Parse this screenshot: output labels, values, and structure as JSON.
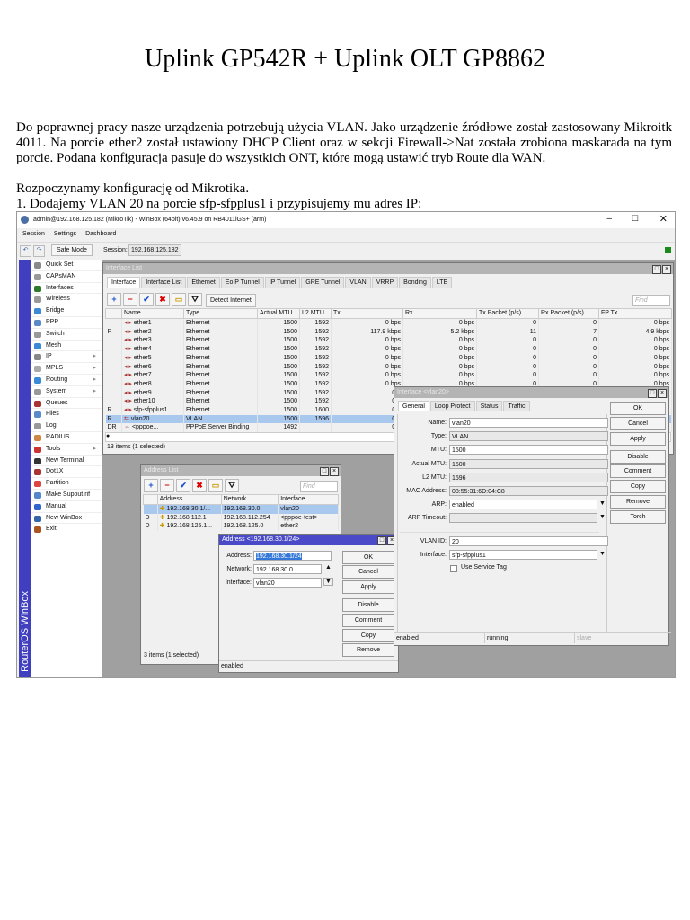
{
  "doc": {
    "title": "Uplink GP542R + Uplink OLT GP8862",
    "p1": "Do poprawnej pracy nasze urządzenia potrzebują użycia VLAN. Jako urządzenie źródłowe został zastosowany Mikroitk 4011. Na porcie ether2 został ustawiony DHCP Client oraz w sekcji Firewall->Nat została zrobiona maskarada na tym porcie. Podana konfiguracja pasuje do wszystkich ONT, które mogą ustawić tryb Route dla WAN.",
    "p2": "Rozpoczynamy konfigurację od Mikrotika.",
    "p3": "1. Dodajemy VLAN 20 na porcie sfp-sfpplus1 i przypisujemy mu adres IP:"
  },
  "winbox": {
    "title": "admin@192.168.125.182 (MikroTik) - WinBox (64bit) v6.45.9 on RB4011iGS+ (arm)",
    "menu": [
      "Session",
      "Settings",
      "Dashboard"
    ],
    "safe_mode": "Safe Mode",
    "session_label": "Session:",
    "session_value": "192.168.125.182",
    "brand": "RouterOS WinBox",
    "sidebar": [
      {
        "label": "Quick Set",
        "c": "#8a8a8a"
      },
      {
        "label": "CAPsMAN",
        "c": "#999"
      },
      {
        "label": "Interfaces",
        "c": "#2d7a2d"
      },
      {
        "label": "Wireless",
        "c": "#999"
      },
      {
        "label": "Bridge",
        "c": "#3a8ad8"
      },
      {
        "label": "PPP",
        "c": "#5a8ac8"
      },
      {
        "label": "Switch",
        "c": "#999"
      },
      {
        "label": "Mesh",
        "c": "#3a8ad8"
      },
      {
        "label": "IP",
        "c": "#888",
        "sub": true
      },
      {
        "label": "MPLS",
        "c": "#aaa",
        "sub": true
      },
      {
        "label": "Routing",
        "c": "#3a8ad8",
        "sub": true
      },
      {
        "label": "System",
        "c": "#999",
        "sub": true
      },
      {
        "label": "Queues",
        "c": "#a33"
      },
      {
        "label": "Files",
        "c": "#5a8ac8"
      },
      {
        "label": "Log",
        "c": "#999"
      },
      {
        "label": "RADIUS",
        "c": "#c84"
      },
      {
        "label": "Tools",
        "c": "#c33",
        "sub": true
      },
      {
        "label": "New Terminal",
        "c": "#333"
      },
      {
        "label": "Dot1X",
        "c": "#a33"
      },
      {
        "label": "Partition",
        "c": "#d44"
      },
      {
        "label": "Make Supout.rif",
        "c": "#58c"
      },
      {
        "label": "Manual",
        "c": "#36c"
      },
      {
        "label": "New WinBox",
        "c": "#36a"
      },
      {
        "label": "Exit",
        "c": "#a52"
      }
    ],
    "iface_list": {
      "title": "Interface List",
      "tabs": [
        "Interface",
        "Interface List",
        "Ethernet",
        "EoIP Tunnel",
        "IP Tunnel",
        "GRE Tunnel",
        "VLAN",
        "VRRP",
        "Bonding",
        "LTE"
      ],
      "detect": "Detect Internet",
      "find": "Find",
      "columns": [
        "",
        "Name",
        "Type",
        "Actual MTU",
        "L2 MTU",
        "Tx",
        "Rx",
        "Tx Packet (p/s)",
        "Rx Packet (p/s)",
        "FP Tx"
      ],
      "rows": [
        [
          "",
          "ether1",
          "Ethernet",
          "1500",
          "1592",
          "0 bps",
          "0 bps",
          "0",
          "0",
          "0 bps"
        ],
        [
          "R",
          "ether2",
          "Ethernet",
          "1500",
          "1592",
          "117.9 kbps",
          "5.2 kbps",
          "11",
          "7",
          "4.9 kbps"
        ],
        [
          "",
          "ether3",
          "Ethernet",
          "1500",
          "1592",
          "0 bps",
          "0 bps",
          "0",
          "0",
          "0 bps"
        ],
        [
          "",
          "ether4",
          "Ethernet",
          "1500",
          "1592",
          "0 bps",
          "0 bps",
          "0",
          "0",
          "0 bps"
        ],
        [
          "",
          "ether5",
          "Ethernet",
          "1500",
          "1592",
          "0 bps",
          "0 bps",
          "0",
          "0",
          "0 bps"
        ],
        [
          "",
          "ether6",
          "Ethernet",
          "1500",
          "1592",
          "0 bps",
          "0 bps",
          "0",
          "0",
          "0 bps"
        ],
        [
          "",
          "ether7",
          "Ethernet",
          "1500",
          "1592",
          "0 bps",
          "0 bps",
          "0",
          "0",
          "0 bps"
        ],
        [
          "",
          "ether8",
          "Ethernet",
          "1500",
          "1592",
          "0 bps",
          "0 bps",
          "0",
          "0",
          "0 bps"
        ],
        [
          "",
          "ether9",
          "Ethernet",
          "1500",
          "1592",
          "0 b",
          "",
          "",
          "",
          ""
        ],
        [
          "",
          "ether10",
          "Ethernet",
          "1500",
          "1592",
          "0 b",
          "",
          "",
          "",
          ""
        ],
        [
          "R",
          "sfp-sfpplus1",
          "Ethernet",
          "1500",
          "1600",
          "0 b",
          "",
          "",
          "",
          ""
        ],
        [
          "R",
          "vlan20",
          "VLAN",
          "1500",
          "1596",
          "0 b",
          "",
          "",
          "",
          ""
        ],
        [
          "DR",
          "<pppoe...",
          "PPPoE Server Binding",
          "1492",
          "",
          "0 b",
          "",
          "",
          "",
          ""
        ]
      ],
      "selected": 11,
      "status": "13 items (1 selected)"
    },
    "vlan_dialog": {
      "title": "Interface <vlan20>",
      "tabs": [
        "General",
        "Loop Protect",
        "Status",
        "Traffic"
      ],
      "fields": [
        {
          "label": "Name:",
          "value": "vlan20",
          "ro": false
        },
        {
          "label": "Type:",
          "value": "VLAN",
          "ro": true
        },
        {
          "label": "MTU:",
          "value": "1500",
          "ro": false
        },
        {
          "label": "Actual MTU:",
          "value": "1500",
          "ro": true
        },
        {
          "label": "L2 MTU:",
          "value": "1596",
          "ro": true
        },
        {
          "label": "MAC Address:",
          "value": "08:55:31:6D:04:C8",
          "ro": true
        },
        {
          "label": "ARP:",
          "value": "enabled",
          "ro": false
        },
        {
          "label": "ARP Timeout:",
          "value": "",
          "ro": true
        }
      ],
      "vlan_id_label": "VLAN ID:",
      "vlan_id": "20",
      "iface_label": "Interface:",
      "iface": "sfp-sfpplus1",
      "service_tag": "Use Service Tag",
      "buttons": [
        "OK",
        "Cancel",
        "Apply",
        "Disable",
        "Comment",
        "Copy",
        "Remove",
        "Torch"
      ],
      "status": [
        "enabled",
        "running",
        "slave"
      ]
    },
    "addr_list": {
      "title": "Address List",
      "find": "Find",
      "columns": [
        "",
        "Address",
        "Network",
        "Interface"
      ],
      "rows": [
        [
          "",
          "192.168.30.1/...",
          "192.168.30.0",
          "vlan20"
        ],
        [
          "D",
          "192.168.112.1",
          "192.168.112.254",
          "<pppoe-test>"
        ],
        [
          "D",
          "192.168.125.1...",
          "192.168.125.0",
          "ether2"
        ]
      ],
      "status": "3 items (1 selected)"
    },
    "addr_dialog": {
      "title": "Address <192.168.30.1/24>",
      "address_label": "Address:",
      "address": "192.168.30.1/24",
      "network_label": "Network:",
      "network": "192.168.30.0",
      "iface_label": "Interface:",
      "iface": "vlan20",
      "buttons": [
        "OK",
        "Cancel",
        "Apply",
        "Disable",
        "Comment",
        "Copy",
        "Remove"
      ],
      "status": "enabled"
    }
  }
}
